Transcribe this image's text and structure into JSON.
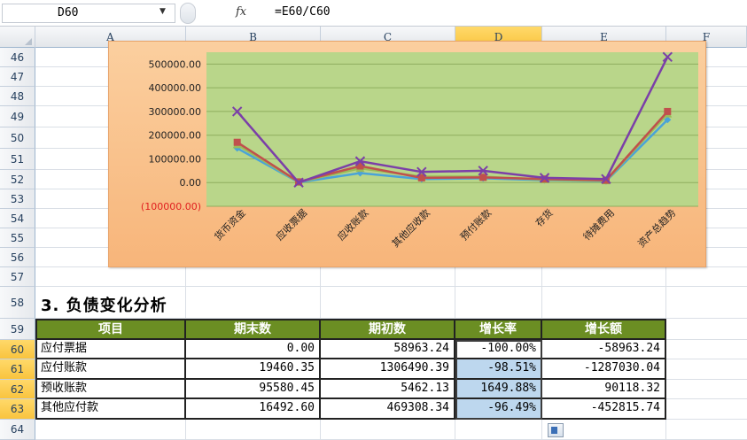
{
  "formula_bar": {
    "name_box": "D60",
    "fx": "fx",
    "formula": "=E60/C60"
  },
  "columns": [
    "A",
    "B",
    "C",
    "D",
    "E",
    "F"
  ],
  "active_column": "D",
  "rows": [
    "46",
    "47",
    "48",
    "49",
    "50",
    "51",
    "52",
    "53",
    "54",
    "55",
    "56",
    "57",
    "58",
    "59",
    "60",
    "61",
    "62",
    "63",
    "64"
  ],
  "active_rows": [
    "60",
    "61",
    "62",
    "63"
  ],
  "chart_data": {
    "type": "line",
    "categories": [
      "货币资金",
      "应收票据",
      "应收账款",
      "其他应收款",
      "预付账款",
      "存货",
      "待摊费用",
      "资产总趋势"
    ],
    "y_ticks": [
      "500000.00",
      "400000.00",
      "300000.00",
      "200000.00",
      "100000.00",
      "0.00",
      "(100000.00)"
    ],
    "ylim": [
      -100000,
      550000
    ],
    "grid": true,
    "colors": {
      "plot_bg": "#b9d68a",
      "negative_tick": "#e02020"
    },
    "series": [
      {
        "color": "#7b3fa8",
        "marker": "x",
        "values": [
          300000,
          0,
          90000,
          45000,
          50000,
          20000,
          15000,
          530000
        ]
      },
      {
        "color": "#c0504d",
        "marker": "square",
        "values": [
          170000,
          3000,
          70000,
          20000,
          22000,
          15000,
          10000,
          300000
        ]
      },
      {
        "color": "#9bbb59",
        "marker": "triangle",
        "values": [
          160000,
          2000,
          60000,
          25000,
          25000,
          12000,
          8000,
          290000
        ]
      },
      {
        "color": "#4aa3d8",
        "marker": "diamond",
        "values": [
          145000,
          1000,
          40000,
          15000,
          18000,
          10000,
          6000,
          265000
        ]
      }
    ]
  },
  "section_title": "3. 负债变化分析",
  "table": {
    "headers": [
      "项目",
      "期末数",
      "期初数",
      "增长率",
      "增长额"
    ],
    "rows": [
      [
        "应付票据",
        "0.00",
        "58963.24",
        "-100.00%",
        "-58963.24"
      ],
      [
        "应付账款",
        "19460.35",
        "1306490.39",
        "-98.51%",
        "-1287030.04"
      ],
      [
        "预收账款",
        "95580.45",
        "5462.13",
        "1649.88%",
        "90118.32"
      ],
      [
        "其他应付款",
        "16492.60",
        "469308.34",
        "-96.49%",
        "-452815.74"
      ]
    ],
    "header_bg": "#6b8e23",
    "rate_highlight": "#bdd7ee"
  }
}
